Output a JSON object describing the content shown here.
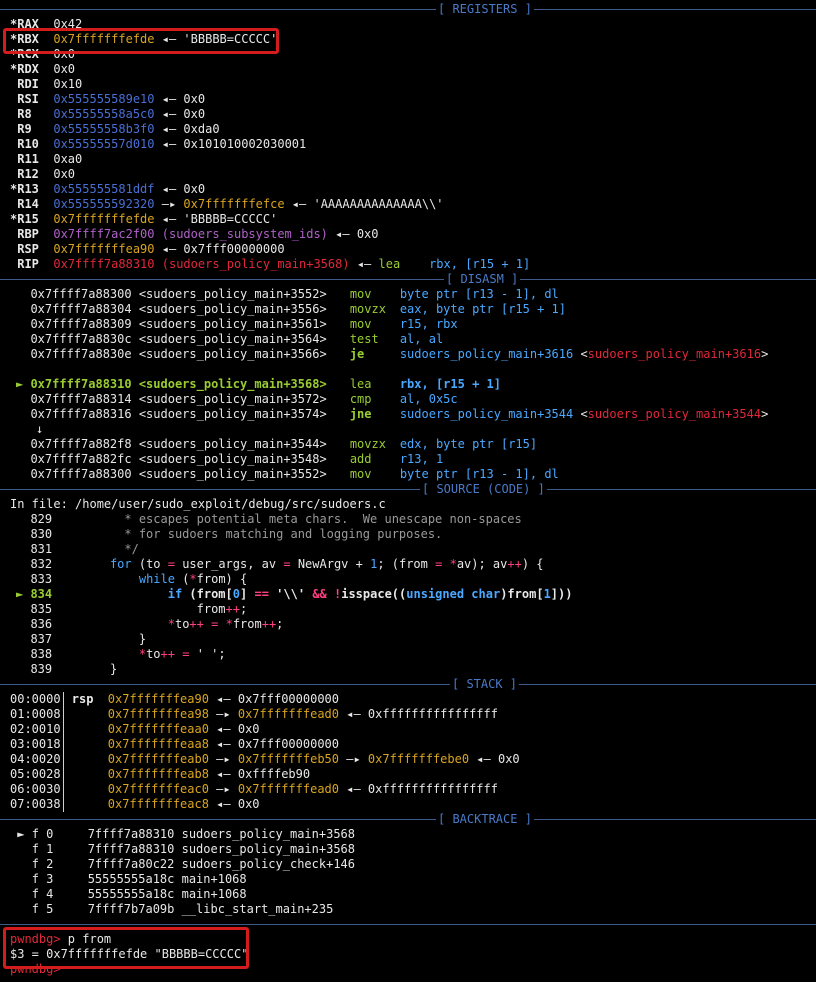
{
  "headers": {
    "registers": "[ REGISTERS ]",
    "disasm": "[ DISASM ]",
    "source": "[ SOURCE (CODE) ]",
    "stack": "[ STACK ]",
    "backtrace": "[ BACKTRACE ]"
  },
  "registers": [
    {
      "name": "*RAX",
      "value": "0x42"
    },
    {
      "name": "*RBX",
      "addr": "0x7fffffffefde",
      "arrow": " ◂— ",
      "str": "'BBBBB=CCCCC'"
    },
    {
      "name": "*RCX",
      "value": "0x0"
    },
    {
      "name": "*RDX",
      "value": "0x0"
    },
    {
      "name": " RDI",
      "value": "0x10"
    },
    {
      "name": " RSI",
      "addr": "0x555555589e10",
      "arrow": " ◂— ",
      "value": "0x0"
    },
    {
      "name": " R8",
      "addr": "0x55555558a5c0",
      "arrow": " ◂— ",
      "value": "0x0"
    },
    {
      "name": " R9",
      "addr": "0x55555558b3f0",
      "arrow": " ◂— ",
      "value": "0xda0"
    },
    {
      "name": " R10",
      "addr": "0x55555557d010",
      "arrow": " ◂— ",
      "value": "0x101010002030001"
    },
    {
      "name": " R11",
      "value": "0xa0"
    },
    {
      "name": " R12",
      "value": "0x0"
    },
    {
      "name": "*R13",
      "addr": "0x555555581ddf",
      "arrow": " ◂— ",
      "value": "0x0"
    },
    {
      "name": " R14",
      "addr": "0x555555592320",
      "arrow": " —▸ ",
      "addr2": "0x7fffffffefce",
      "arrow2": " ◂— ",
      "str": "'AAAAAAAAAAAAAA\\\\'"
    },
    {
      "name": "*R15",
      "addr": "0x7fffffffefde",
      "arrow": " ◂— ",
      "str": "'BBBBB=CCCCC'"
    },
    {
      "name": " RBP",
      "addr": "0x7ffff7ac2f00",
      "sym": " (sudoers_subsystem_ids)",
      "arrow": " ◂— ",
      "value": "0x0"
    },
    {
      "name": " RSP",
      "addr": "0x7fffffffea90",
      "arrow": " ◂— ",
      "value": "0x7fff00000000"
    },
    {
      "name": " RIP",
      "addr": "0x7ffff7a88310",
      "sym": " (sudoers_policy_main+3568)",
      "arrow": " ◂— ",
      "ins": "lea    rbx, [r15 + 1]"
    }
  ],
  "disasm": [
    {
      "marker": "  ",
      "addr": "0x7ffff7a88300",
      "loc": "<sudoers_policy_main+3552>",
      "mn": "mov",
      "ops": "byte ptr [r13 - 1], dl"
    },
    {
      "marker": "  ",
      "addr": "0x7ffff7a88304",
      "loc": "<sudoers_policy_main+3556>",
      "mn": "movzx",
      "ops": "eax, byte ptr [r15 + 1]"
    },
    {
      "marker": "  ",
      "addr": "0x7ffff7a88309",
      "loc": "<sudoers_policy_main+3561>",
      "mn": "mov",
      "ops": "r15, rbx"
    },
    {
      "marker": "  ",
      "addr": "0x7ffff7a8830c",
      "loc": "<sudoers_policy_main+3564>",
      "mn": "test",
      "ops": "al, al"
    },
    {
      "marker": "  ",
      "addr": "0x7ffff7a8830e",
      "loc": "<sudoers_policy_main+3566>",
      "mn": "je",
      "ops": "sudoers_policy_main+3616",
      "target": "<sudoers_policy_main+3616>"
    },
    {
      "blank": true
    },
    {
      "marker": "► ",
      "addr": "0x7ffff7a88310",
      "loc": "<sudoers_policy_main+3568>",
      "mn": "lea",
      "ops": "rbx, [r15 + 1]",
      "current": true
    },
    {
      "marker": "  ",
      "addr": "0x7ffff7a88314",
      "loc": "<sudoers_policy_main+3572>",
      "mn": "cmp",
      "ops": "al, 0x5c"
    },
    {
      "marker": "  ",
      "addr": "0x7ffff7a88316",
      "loc": "<sudoers_policy_main+3574>",
      "mn": "jne",
      "ops": "sudoers_policy_main+3544",
      "target": "<sudoers_policy_main+3544>"
    },
    {
      "down": "↓"
    },
    {
      "marker": "  ",
      "addr": "0x7ffff7a882f8",
      "loc": "<sudoers_policy_main+3544>",
      "mn": "movzx",
      "ops": "edx, byte ptr [r15]"
    },
    {
      "marker": "  ",
      "addr": "0x7ffff7a882fc",
      "loc": "<sudoers_policy_main+3548>",
      "mn": "add",
      "ops": "r13, 1"
    },
    {
      "marker": "  ",
      "addr": "0x7ffff7a88300",
      "loc": "<sudoers_policy_main+3552>",
      "mn": "mov",
      "ops": "byte ptr [r13 - 1], dl"
    }
  ],
  "source": {
    "file": "In file: /home/user/sudo_exploit/debug/src/sudoers.c",
    "lines": [
      {
        "n": "829",
        "code": "          * escapes potential meta chars.  We unescape non-spaces"
      },
      {
        "n": "830",
        "code": "          * for sudoers matching and logging purposes."
      },
      {
        "n": "831",
        "code": "          */"
      },
      {
        "n": "832",
        "code": "        for (to = user_args, av = NewArgv + 1; (from = *av); av++) {"
      },
      {
        "n": "833",
        "code": "            while (*from) {"
      },
      {
        "n": "834",
        "code": "                if (from[0] == '\\\\' && !isspace((unsigned char)from[1]))"
      },
      {
        "n": "835",
        "code": "                    from++;"
      },
      {
        "n": "836",
        "code": "                *to++ = *from++;"
      },
      {
        "n": "837",
        "code": "            }"
      },
      {
        "n": "838",
        "code": "            *to++ = ' ';"
      },
      {
        "n": "839",
        "code": "        }"
      }
    ],
    "current_marker": "► "
  },
  "stack": [
    {
      "off": "00:0000",
      "reg": "rsp",
      "addr": "0x7fffffffea90",
      "rest": [
        {
          "t": " ◂— "
        },
        {
          "t": "0x7fff00000000"
        }
      ]
    },
    {
      "off": "01:0008",
      "reg": "",
      "addr": "0x7fffffffea98",
      "rest": [
        {
          "t": " —▸ "
        },
        {
          "t": "0x7fffffffead0",
          "c": "ye"
        },
        {
          "t": " ◂— "
        },
        {
          "t": "0xffffffffffffffff"
        }
      ]
    },
    {
      "off": "02:0010",
      "reg": "",
      "addr": "0x7fffffffeaa0",
      "rest": [
        {
          "t": " ◂— "
        },
        {
          "t": "0x0"
        }
      ]
    },
    {
      "off": "03:0018",
      "reg": "",
      "addr": "0x7fffffffeaa8",
      "rest": [
        {
          "t": " ◂— "
        },
        {
          "t": "0x7fff00000000"
        }
      ]
    },
    {
      "off": "04:0020",
      "reg": "",
      "addr": "0x7fffffffeab0",
      "rest": [
        {
          "t": " —▸ "
        },
        {
          "t": "0x7fffffffeb50",
          "c": "ye"
        },
        {
          "t": " —▸ "
        },
        {
          "t": "0x7fffffffebe0",
          "c": "ye"
        },
        {
          "t": " ◂— "
        },
        {
          "t": "0x0"
        }
      ]
    },
    {
      "off": "05:0028",
      "reg": "",
      "addr": "0x7fffffffeab8",
      "rest": [
        {
          "t": " ◂— "
        },
        {
          "t": "0xffffeb90"
        }
      ]
    },
    {
      "off": "06:0030",
      "reg": "",
      "addr": "0x7fffffffeac0",
      "rest": [
        {
          "t": " —▸ "
        },
        {
          "t": "0x7fffffffead0",
          "c": "ye"
        },
        {
          "t": " ◂— "
        },
        {
          "t": "0xffffffffffffffff"
        }
      ]
    },
    {
      "off": "07:0038",
      "reg": "",
      "addr": "0x7fffffffeac8",
      "rest": [
        {
          "t": " ◂— "
        },
        {
          "t": "0x0"
        }
      ]
    }
  ],
  "backtrace": [
    {
      "marker": " ► ",
      "frame": "f 0",
      "addr": "7ffff7a88310",
      "sym": "sudoers_policy_main+3568"
    },
    {
      "marker": "   ",
      "frame": "f 1",
      "addr": "7ffff7a88310",
      "sym": "sudoers_policy_main+3568"
    },
    {
      "marker": "   ",
      "frame": "f 2",
      "addr": "7ffff7a80c22",
      "sym": "sudoers_policy_check+146"
    },
    {
      "marker": "   ",
      "frame": "f 3",
      "addr": "55555555a18c",
      "sym": "main+1068"
    },
    {
      "marker": "   ",
      "frame": "f 4",
      "addr": "55555555a18c",
      "sym": "main+1068"
    },
    {
      "marker": "   ",
      "frame": "f 5",
      "addr": "7ffff7b7a09b",
      "sym": "__libc_start_main+235"
    }
  ],
  "prompt": {
    "label": "pwndbg>",
    "command": " p from",
    "result": "$3 = 0x7fffffffefde \"BBBBB=CCCCC\""
  },
  "colors": {
    "background": "#000000",
    "address": "#4a6fd4",
    "stack_address": "#d9a521",
    "highlight_box": "#d41c1c",
    "current_line": "#9acd32",
    "header": "#4a7ac8"
  }
}
